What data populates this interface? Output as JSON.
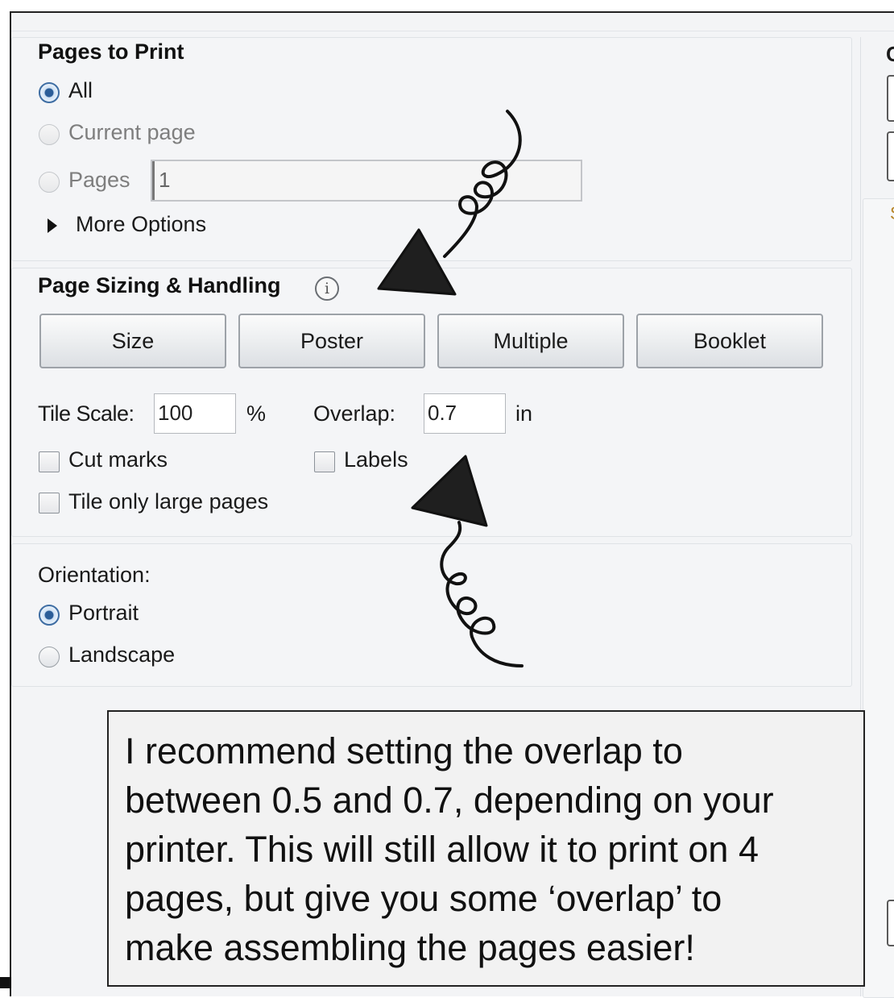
{
  "pages_to_print": {
    "heading": "Pages to Print",
    "all_label": "All",
    "current_page_label": "Current page",
    "pages_label": "Pages",
    "pages_value": "1",
    "more_options_label": "More Options"
  },
  "page_sizing": {
    "heading": "Page Sizing & Handling",
    "info_icon": "info-icon",
    "buttons": [
      "Size",
      "Poster",
      "Multiple",
      "Booklet"
    ],
    "tile_scale_label": "Tile Scale:",
    "tile_scale_value": "100",
    "tile_scale_unit": "%",
    "overlap_label": "Overlap:",
    "overlap_value": "0.7",
    "overlap_unit": "in",
    "cut_marks_label": "Cut marks",
    "labels_label": "Labels",
    "tile_large_label": "Tile only large pages"
  },
  "orientation": {
    "heading": "Orientation:",
    "portrait_label": "Portrait",
    "landscape_label": "Landscape"
  },
  "note": {
    "lines": [
      "I recommend setting the overlap to",
      "between 0.5 and 0.7, depending on your",
      "printer. This will still allow it to print on 4",
      "pages, but give you some ‘overlap’ to",
      "make assembling the pages easier!"
    ]
  },
  "right_column": {
    "heading_fragment": "C",
    "letter_fragment": "S"
  },
  "colors": {
    "radio_checked": "#2b5d98",
    "panel_bg": "#f4f5f7",
    "arrow_fill": "#1f1f1f"
  }
}
